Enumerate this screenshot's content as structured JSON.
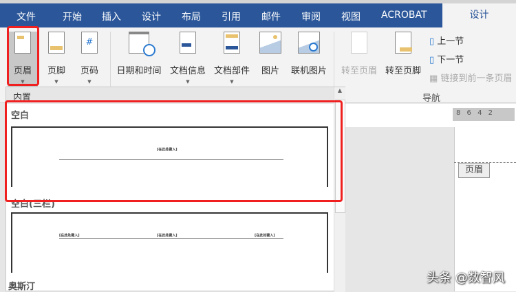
{
  "tabs": [
    "文件",
    "开始",
    "插入",
    "设计",
    "布局",
    "引用",
    "邮件",
    "审阅",
    "视图",
    "ACROBAT"
  ],
  "active_tab": "设计",
  "ribbon": {
    "buttons": [
      {
        "label": "页眉"
      },
      {
        "label": "页脚"
      },
      {
        "label": "页码"
      },
      {
        "label": "日期和时间"
      },
      {
        "label": "文档信息"
      },
      {
        "label": "文档部件"
      },
      {
        "label": "图片"
      },
      {
        "label": "联机图片"
      },
      {
        "label": "转至页眉"
      },
      {
        "label": "转至页脚"
      }
    ],
    "nav": {
      "prev": "上一节",
      "next": "下一节",
      "link": "链接到前一条页眉",
      "group_label": "导航"
    }
  },
  "panel": {
    "header": "内置",
    "items": [
      {
        "title": "空白",
        "placeholder": "[在此处键入]"
      },
      {
        "title": "空白(三栏)",
        "placeholders": [
          "[在此处键入]",
          "[在此处键入]",
          "[在此处键入]"
        ]
      },
      {
        "title": "奥斯汀"
      }
    ]
  },
  "document": {
    "ruler": "8 6 4 2",
    "header_tag": "页眉"
  },
  "watermark": "头条 @数智风",
  "colors": {
    "brand": "#2b579a",
    "highlight": "#f02020"
  }
}
